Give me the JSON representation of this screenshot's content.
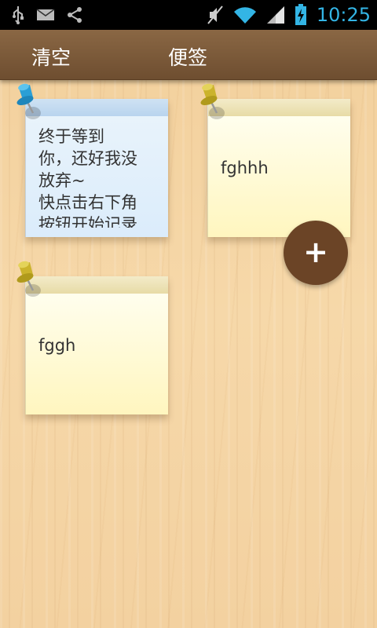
{
  "status_bar": {
    "time": "10:25",
    "icons": [
      "usb-icon",
      "mail-icon",
      "share-icon",
      "mute-icon",
      "wifi-icon",
      "signal-icon",
      "battery-icon"
    ]
  },
  "action_bar": {
    "clear_label": "清空",
    "title": "便签"
  },
  "notes": [
    {
      "text": "终于等到\n你，还好我没\n放弃~\n快点击右下角\n按钮开始记录",
      "color": "blue",
      "pin": "blue-pin-icon"
    },
    {
      "text": "fghhh",
      "color": "yellow",
      "pin": "yellow-pin-icon"
    },
    {
      "text": "fggh",
      "color": "yellow",
      "pin": "yellow-pin-icon"
    }
  ],
  "fab": {
    "label": "+"
  },
  "colors": {
    "status_time": "#33b5e5",
    "action_bar": "#7a5838",
    "background_wood": "#f3cf9a",
    "fab": "#6b4426"
  }
}
